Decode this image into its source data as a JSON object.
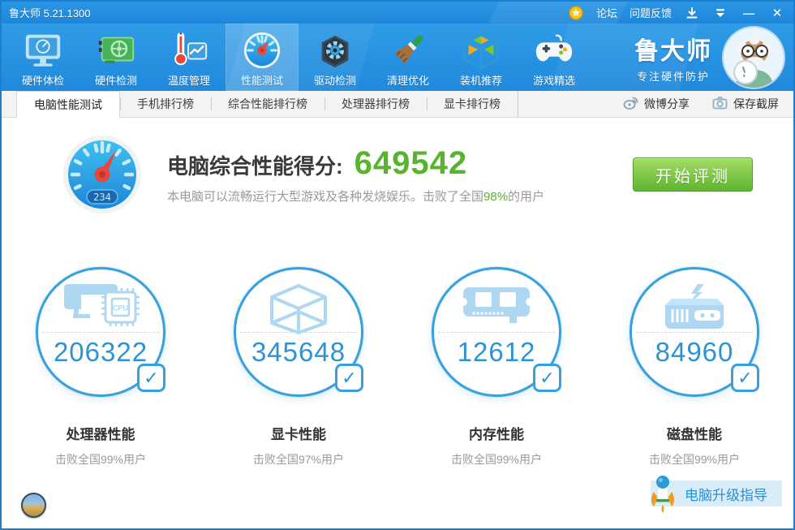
{
  "window": {
    "title": "鲁大师 5.21.1300",
    "links": {
      "forum": "论坛",
      "feedback": "问题反馈"
    }
  },
  "toolbar": {
    "items": [
      {
        "label": "硬件体检"
      },
      {
        "label": "硬件检测"
      },
      {
        "label": "温度管理"
      },
      {
        "label": "性能测试"
      },
      {
        "label": "驱动检测"
      },
      {
        "label": "清理优化"
      },
      {
        "label": "装机推荐"
      },
      {
        "label": "游戏精选"
      }
    ],
    "brand": {
      "name": "鲁大师",
      "slogan": "专注硬件防护"
    }
  },
  "tabs": [
    {
      "label": "电脑性能测试"
    },
    {
      "label": "手机排行榜"
    },
    {
      "label": "综合性能排行榜"
    },
    {
      "label": "处理器排行榜"
    },
    {
      "label": "显卡排行榜"
    }
  ],
  "tab_actions": {
    "weibo": "微博分享",
    "screenshot": "保存截屏"
  },
  "score": {
    "gauge_value": "234",
    "title": "电脑综合性能得分:",
    "value": "649542",
    "desc_prefix": "本电脑可以流畅运行大型游戏及各种发烧娱乐。击败了全国",
    "desc_percent": "98%",
    "desc_suffix": "的用户",
    "start_button": "开始评测"
  },
  "benchmarks": [
    {
      "score": "206322",
      "name": "处理器性能",
      "beat": "击败全国99%用户"
    },
    {
      "score": "345648",
      "name": "显卡性能",
      "beat": "击败全国97%用户"
    },
    {
      "score": "12612",
      "name": "内存性能",
      "beat": "击败全国99%用户"
    },
    {
      "score": "84960",
      "name": "磁盘性能",
      "beat": "击败全国99%用户"
    }
  ],
  "footer": {
    "upgrade_guide": "电脑升级指导"
  },
  "icons": {
    "cpu_chip_label": "CPU",
    "check": "✓",
    "minimize": "—",
    "close": "✕"
  },
  "colors": {
    "accent_blue": "#2591e2",
    "score_green": "#57b42c",
    "circle_blue": "#38a1dd"
  }
}
